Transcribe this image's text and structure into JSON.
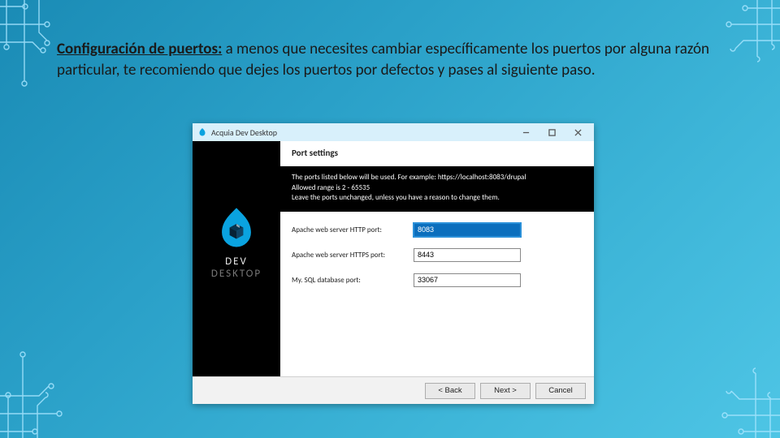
{
  "slide": {
    "heading": "Configuración de puertos:",
    "body": " a menos que necesites cambiar específicamente los puertos por alguna razón particular, te recomiendo que dejes los puertos por defectos y pases al siguiente paso."
  },
  "window": {
    "title": "Acquia Dev Desktop",
    "header": "Port settings",
    "instructions": {
      "line1": "The ports listed below will be used.  For example: https://localhost:8083/drupal",
      "line2": "Allowed range is 2 - 65535",
      "line3": "Leave the ports unchanged, unless you have a reason to change them."
    },
    "fields": {
      "http": {
        "label": "Apache web server HTTP port:",
        "value": "8083"
      },
      "https": {
        "label": "Apache web server HTTPS port:",
        "value": "8443"
      },
      "mysql": {
        "label": "My. SQL database port:",
        "value": "33067"
      }
    },
    "buttons": {
      "back": "< Back",
      "next": "Next >",
      "cancel": "Cancel"
    },
    "brand": {
      "dev": "DEV",
      "desktop": "DESKTOP"
    }
  }
}
